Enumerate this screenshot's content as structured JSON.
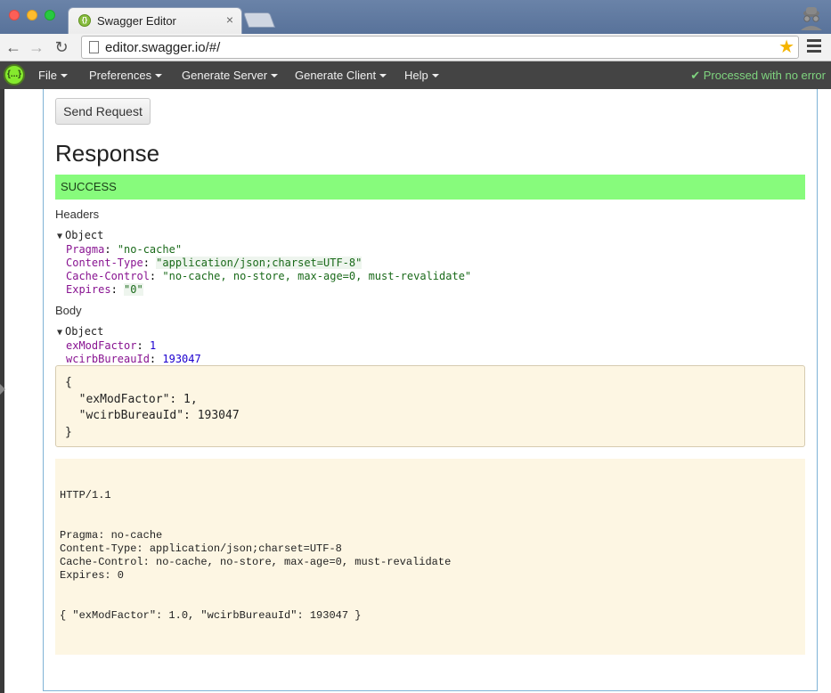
{
  "browser": {
    "tab_title": "Swagger Editor",
    "tab_close": "×",
    "url": "editor.swagger.io/#/"
  },
  "app": {
    "logo_text": "{...}",
    "menus": [
      {
        "label": "File"
      },
      {
        "label": "Preferences"
      },
      {
        "label": "Generate Server"
      },
      {
        "label": "Generate Client"
      },
      {
        "label": "Help"
      }
    ],
    "status": "✔ Processed with no error",
    "status_color": "#7fd47f"
  },
  "request": {
    "send_label": "Send Request"
  },
  "response": {
    "title": "Response",
    "status": "SUCCESS",
    "status_color": "#87fb7c",
    "headers_label": "Headers",
    "headers_object": {
      "label": "Object",
      "entries": [
        {
          "key": "Pragma",
          "value": "\"no-cache\""
        },
        {
          "key": "Content-Type",
          "value": "\"application/json;charset=UTF-8\""
        },
        {
          "key": "Cache-Control",
          "value": "\"no-cache, no-store, max-age=0, must-revalidate\""
        },
        {
          "key": "Expires",
          "value": "\"0\""
        }
      ]
    },
    "body_label": "Body",
    "body_object": {
      "label": "Object",
      "entries": [
        {
          "key": "exModFactor",
          "value": "1"
        },
        {
          "key": "wcirbBureauId",
          "value": "193047"
        }
      ]
    },
    "json_lines": [
      "{",
      "  \"exModFactor\": 1,",
      "  \"wcirbBureauId\": 193047",
      "}"
    ],
    "raw": {
      "status_line": "HTTP/1.1",
      "header_lines": [
        "Pragma: no-cache",
        "Content-Type: application/json;charset=UTF-8",
        "Cache-Control: no-cache, no-store, max-age=0, must-revalidate",
        "Expires: 0"
      ],
      "body_line": "{ \"exModFactor\": 1.0, \"wcirbBureauId\": 193047 }"
    }
  }
}
